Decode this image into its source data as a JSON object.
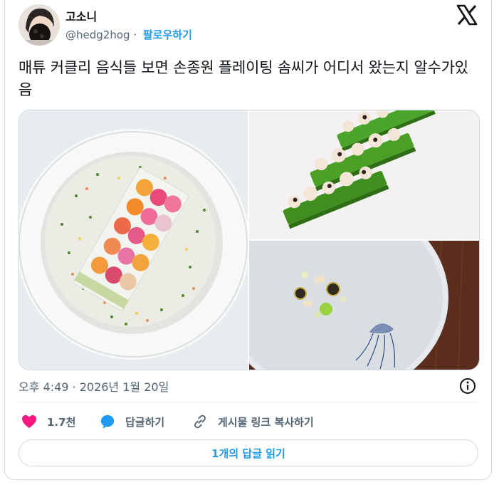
{
  "author": {
    "display_name": "고소니",
    "handle": "@hedg2hog",
    "separator": "·",
    "follow_label": "팔로우하기"
  },
  "post": {
    "text": "매튜 커클리 음식들 보면 손종원 플레이팅 솜씨가 어디서 왔는지 알수가있음",
    "timestamp": "오후 4:49 · 2026년 1월 20일"
  },
  "actions": {
    "likes_count": "1.7천",
    "reply_label": "답글하기",
    "copy_link_label": "게시물 링크 복사하기"
  },
  "read_replies_label": "1개의 답글 읽기",
  "colors": {
    "accent": "#1d9bf0",
    "like": "#f91880",
    "text": "#0f1419",
    "secondary": "#536471"
  },
  "icons": [
    "x-logo-icon",
    "info-icon",
    "heart-icon",
    "reply-bubble-icon",
    "link-icon"
  ]
}
